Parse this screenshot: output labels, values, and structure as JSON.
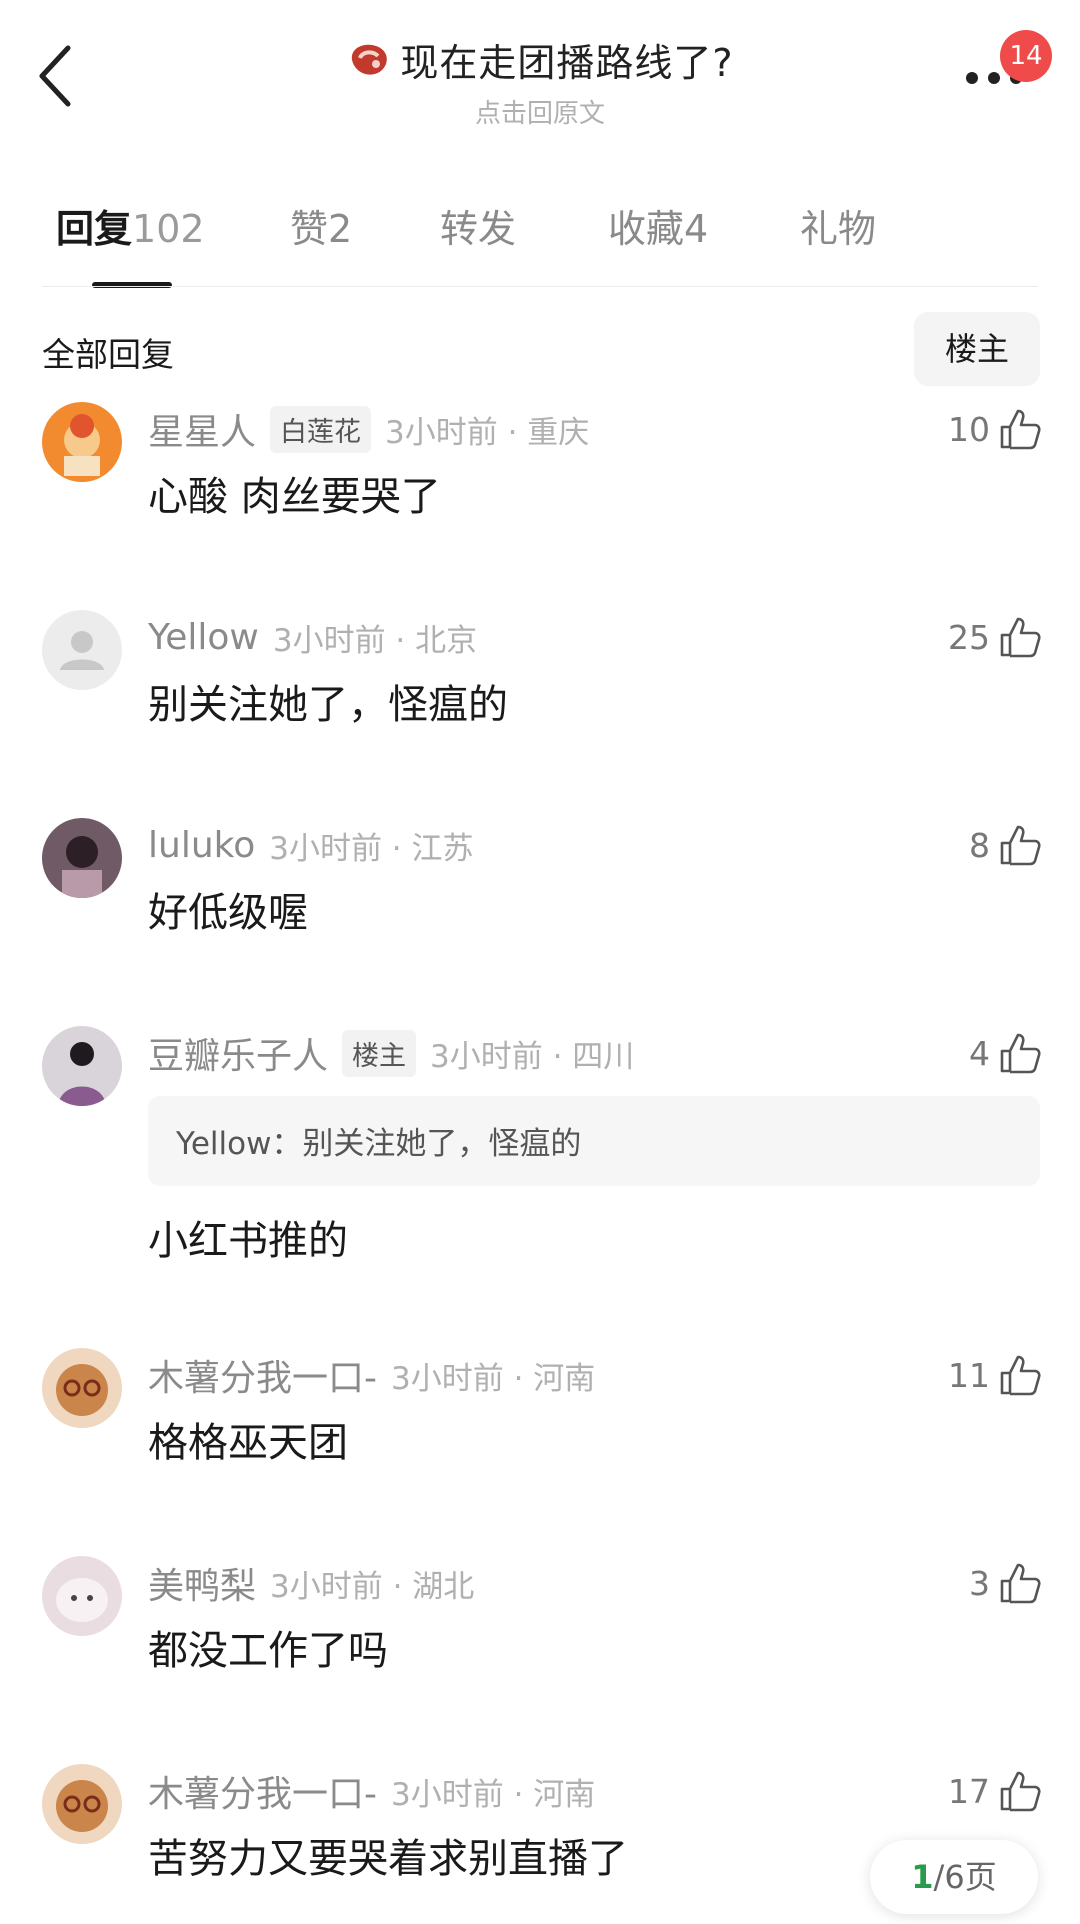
{
  "header": {
    "title": "现在走团播路线了?",
    "subtitle": "点击回原文",
    "badge_count": "14"
  },
  "tabs": [
    {
      "label": "回复",
      "count": "102"
    },
    {
      "label": "赞",
      "count": "2"
    },
    {
      "label": "转发",
      "count": ""
    },
    {
      "label": "收藏",
      "count": "4"
    },
    {
      "label": "礼物",
      "count": ""
    }
  ],
  "section": {
    "title": "全部回复",
    "owner_filter": "楼主"
  },
  "comments": [
    {
      "user": "星星人",
      "tag": "白莲花",
      "time": "3小时前 · 重庆",
      "likes": "10",
      "text": "心酸 肉丝要哭了"
    },
    {
      "user": "Yellow",
      "tag": "",
      "time": "3小时前 · 北京",
      "likes": "25",
      "text": "别关注她了，怪瘟的"
    },
    {
      "user": "luluko",
      "tag": "",
      "time": "3小时前 · 江苏",
      "likes": "8",
      "text": "好低级喔"
    },
    {
      "user": "豆瓣乐子人",
      "tag": "楼主",
      "time": "3小时前 · 四川",
      "likes": "4",
      "quote": "Yellow：别关注她了，怪瘟的",
      "text": "小红书推的"
    },
    {
      "user": "木薯分我一口-",
      "tag": "",
      "time": "3小时前 · 河南",
      "likes": "11",
      "text": "格格巫天团"
    },
    {
      "user": "美鸭梨",
      "tag": "",
      "time": "3小时前 · 湖北",
      "likes": "3",
      "text": "都没工作了吗"
    },
    {
      "user": "木薯分我一口-",
      "tag": "",
      "time": "3小时前 · 河南",
      "likes": "17",
      "text": "苦努力又要哭着求别直播了"
    }
  ],
  "pager": {
    "current": "1",
    "total_label": "/6页"
  },
  "colors": {
    "badge": "#ef4b4b",
    "pager_current": "#2a9a4c"
  }
}
